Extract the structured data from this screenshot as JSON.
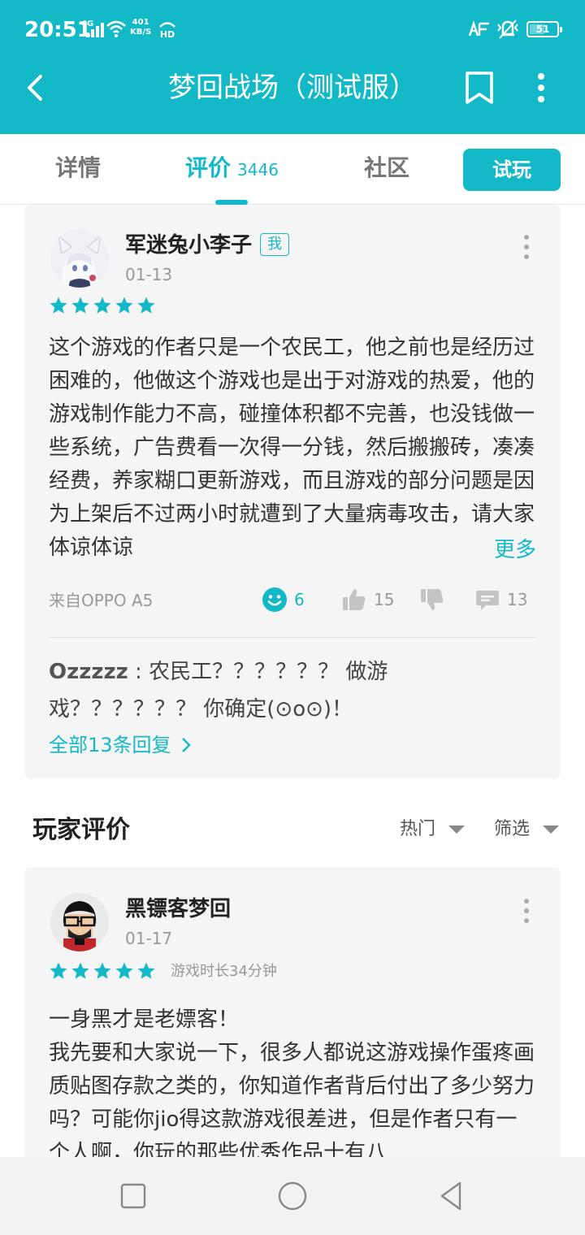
{
  "status_bar": {
    "time": "20:51",
    "network": "4G",
    "speed_value": "401",
    "speed_unit": "KB/S",
    "hd": "HD",
    "battery": "51"
  },
  "nav": {
    "title": "梦回战场（测试服）",
    "icons": [
      "back-arrow-icon",
      "bookmark-icon",
      "more-vertical-icon"
    ]
  },
  "tabs": {
    "detail": "详情",
    "reviews": "评价",
    "reviews_count": "3446",
    "community": "社区",
    "try_button": "试玩"
  },
  "featured_review": {
    "username": "军迷兔小李子",
    "badge": "我",
    "date": "01-13",
    "rating": 5,
    "text": "这个游戏的作者只是一个农民工，他之前也是经历过困难的，他做这个游戏也是出于对游戏的热爱，他的游戏制作能力不高，碰撞体积都不完善，也没钱做一些系统，广告费看一次得一分钱，然后搬搬砖，凑凑经费，养家糊口更新游戏，而且游戏的部分问题是因为上架后不过两小时就遭到了大量病毒攻击，请大家体谅体谅",
    "more": "更多",
    "device": "来自OPPO A5",
    "smile_count": "6",
    "like_count": "15",
    "comment_count": "13",
    "reply": {
      "user": "Ozzzzz",
      "separator": " : ",
      "text": "农民工？？？？？？ 做游戏？？？？？？ 你确定(⊙o⊙)！"
    },
    "all_replies": "全部13条回复"
  },
  "player_reviews": {
    "title": "玩家评价",
    "sort_label": "热门",
    "filter_label": "筛选"
  },
  "review2": {
    "username": "黑镖客梦回",
    "date": "01-17",
    "rating": 5,
    "playtime": "游戏时长34分钟",
    "text": "一身黑才是老嫖客！\n我先要和大家说一下，很多人都说这游戏操作蛋疼画质贴图存款之类的，你知道作者背后付出了多少努力吗？可能你jio得这款游戏很差进，但是作者只有一个人啊，你玩的那些优秀作品十有八"
  },
  "colors": {
    "accent": "#14b9c8",
    "card_bg": "#f5f5f5",
    "text": "#333333",
    "muted": "#999999"
  }
}
